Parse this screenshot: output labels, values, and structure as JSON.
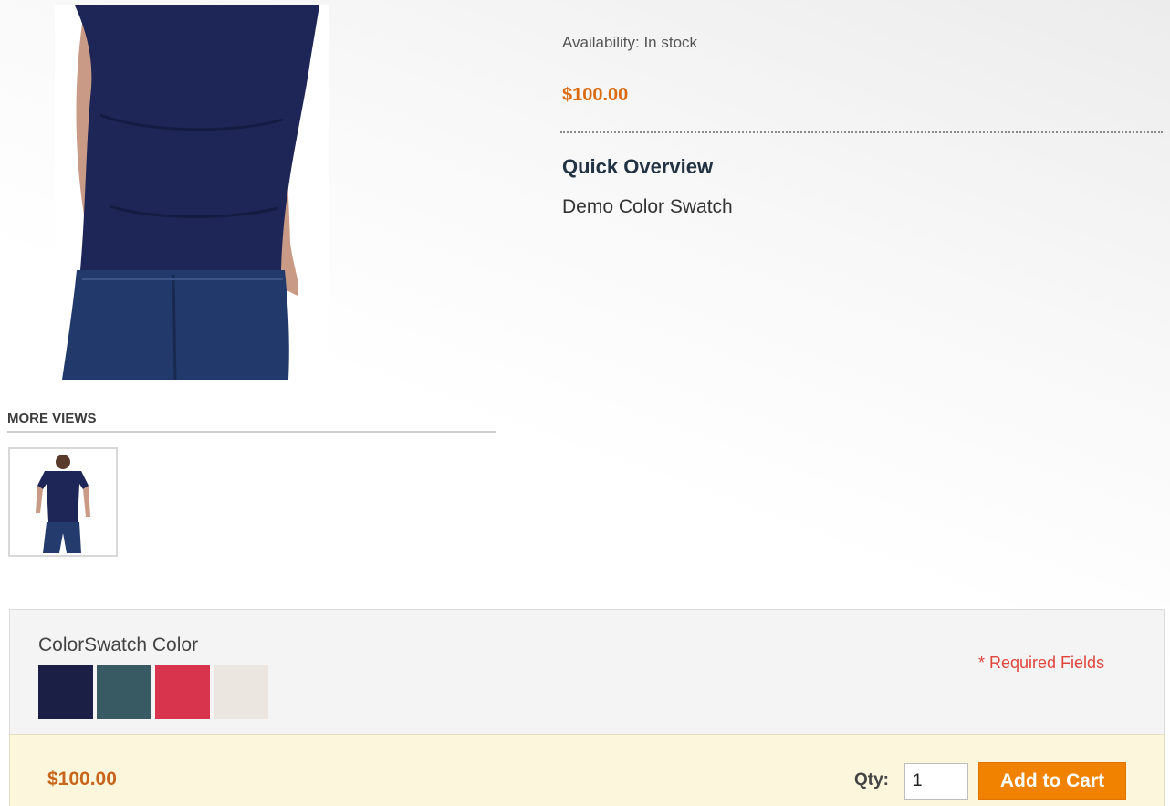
{
  "product": {
    "availability": "Availability: In stock",
    "price": "$100.00",
    "overview_title": "Quick Overview",
    "overview_text": "Demo Color Swatch"
  },
  "gallery": {
    "more_views_title": "MORE VIEWS",
    "main_image_icon": "tshirt-model-photo",
    "thumbnail_icon": "tshirt-model-thumbnail"
  },
  "options": {
    "label": "ColorSwatch Color",
    "required_note": "* Required Fields",
    "swatches": [
      {
        "name": "navy",
        "color": "#1b1f45"
      },
      {
        "name": "teal",
        "color": "#375a63"
      },
      {
        "name": "pink-red",
        "color": "#d9344d"
      },
      {
        "name": "cream",
        "color": "#ebe6df"
      }
    ]
  },
  "cart": {
    "price": "$100.00",
    "qty_label": "Qty:",
    "qty_value": "1",
    "add_to_cart_label": "Add to Cart"
  },
  "colors": {
    "price_orange": "#d96c12",
    "button_orange": "#f18200",
    "required_red": "#e0463c",
    "cart_bar_bg": "#fcf6dc"
  }
}
